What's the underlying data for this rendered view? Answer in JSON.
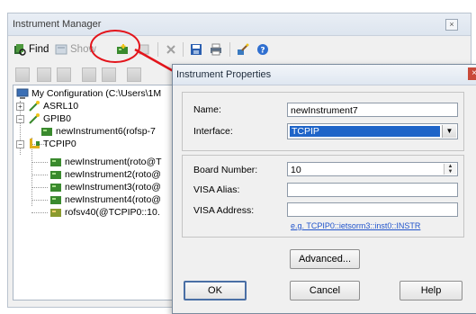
{
  "manager": {
    "title": "Instrument Manager",
    "toolbar": {
      "find_label": "Find",
      "show_label": "Show"
    },
    "tree": {
      "root": "My Configuration (C:\\Users\\1M",
      "items": [
        {
          "label": "ASRL10"
        },
        {
          "label": "GPIB0"
        },
        {
          "label": "newInstrument6(rofsp-7"
        },
        {
          "label": "TCPIP0"
        },
        {
          "label": "newInstrument(roto@T"
        },
        {
          "label": "newInstrument2(roto@"
        },
        {
          "label": "newInstrument3(roto@"
        },
        {
          "label": "newInstrument4(roto@"
        },
        {
          "label": "rofsv40(@TCPIP0::10."
        }
      ]
    }
  },
  "dialog": {
    "title": "Instrument Properties",
    "name_label": "Name:",
    "name_value": "newInstrument7",
    "interface_label": "Interface:",
    "interface_value": "TCPIP",
    "board_label": "Board Number:",
    "board_value": "10",
    "alias_label": "VISA Alias:",
    "alias_value": "",
    "address_label": "VISA Address:",
    "address_value": "",
    "address_hint": "e.g. TCPIP0::ietsorm3::inst0::INSTR",
    "advanced_label": "Advanced...",
    "ok_label": "OK",
    "cancel_label": "Cancel",
    "help_label": "Help"
  },
  "colors": {
    "highlight": "#e3141b",
    "selection": "#1e64c8",
    "link": "#2255cc"
  },
  "icons": [
    "find-icon",
    "show-icon",
    "add-instrument-icon",
    "delete-icon",
    "save-icon",
    "print-icon",
    "wizard-icon",
    "help-icon"
  ]
}
